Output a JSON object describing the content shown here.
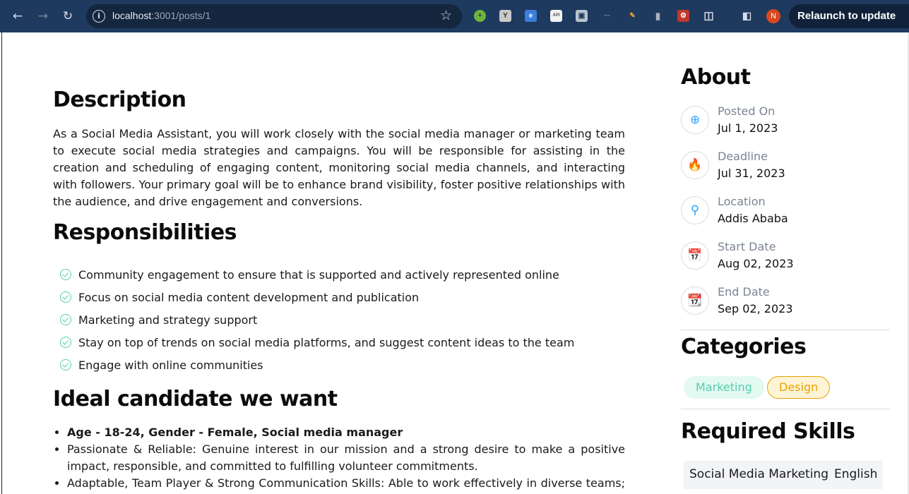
{
  "browser": {
    "url_host": "localhost",
    "url_rest": ":3001/posts/1",
    "relaunch_label": "Relaunch to update",
    "profile_initial": "N"
  },
  "description": {
    "title": "Description",
    "text": "As a Social Media Assistant, you will work closely with the social media manager or marketing team to execute social media strategies and campaigns. You will be responsible for assisting in the creation and scheduling of engaging content, monitoring social media channels, and interacting with followers. Your primary goal will be to enhance brand visibility, foster positive relationships with the audience, and drive engagement and conversions."
  },
  "responsibilities": {
    "title": "Responsibilities",
    "items": [
      "Community engagement to ensure that is supported and actively represented online",
      "Focus on social media content development and publication",
      "Marketing and strategy support",
      "Stay on top of trends on social media platforms, and suggest content ideas to the team",
      "Engage with online communities"
    ]
  },
  "ideal_candidate": {
    "title": "Ideal candidate we want",
    "items": [
      "Age - 18-24, Gender - Female, Social media manager",
      "Passionate & Reliable: Genuine interest in our mission and a strong desire to make a positive impact, responsible, and committed to fulfilling volunteer commitments.",
      "Adaptable, Team Player & Strong Communication Skills: Able to work effectively in diverse teams; and"
    ]
  },
  "about": {
    "title": "About",
    "items": [
      {
        "label": "Posted On",
        "value": "Jul 1, 2023",
        "icon": "plus-circle-icon"
      },
      {
        "label": "Deadline",
        "value": "Jul 31, 2023",
        "icon": "fire-icon"
      },
      {
        "label": "Location",
        "value": "Addis Ababa",
        "icon": "location-pin-icon"
      },
      {
        "label": "Start Date",
        "value": "Aug 02, 2023",
        "icon": "calendar-check-icon"
      },
      {
        "label": "End Date",
        "value": "Sep 02, 2023",
        "icon": "calendar-play-icon"
      }
    ]
  },
  "categories": {
    "title": "Categories",
    "items": [
      "Marketing",
      "Design"
    ]
  },
  "skills": {
    "title": "Required Skills",
    "items": [
      "Social Media Marketing",
      "English"
    ]
  },
  "colors": {
    "accent": "#26a4ff",
    "green": "#56cdad",
    "yellow": "#e8a300",
    "chrome": "#1f3a5f"
  }
}
